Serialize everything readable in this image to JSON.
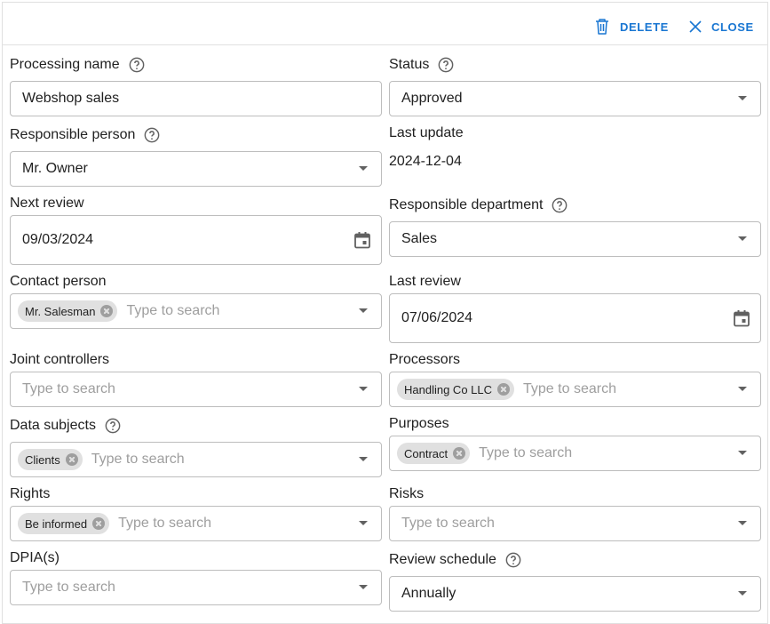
{
  "toolbar": {
    "delete_label": "DELETE",
    "close_label": "CLOSE"
  },
  "placeholder": "Type to search",
  "left": {
    "processing_name": {
      "label": "Processing name",
      "value": "Webshop sales"
    },
    "responsible_person": {
      "label": "Responsible person",
      "value": "Mr. Owner"
    },
    "next_review": {
      "label": "Next review",
      "value": "09/03/2024"
    },
    "contact_person": {
      "label": "Contact person",
      "chip": "Mr. Salesman"
    },
    "joint_controllers": {
      "label": "Joint controllers"
    },
    "data_subjects": {
      "label": "Data subjects",
      "chip": "Clients"
    },
    "rights": {
      "label": "Rights",
      "chip": "Be informed"
    },
    "dpias": {
      "label": "DPIA(s)"
    }
  },
  "right": {
    "status": {
      "label": "Status",
      "value": "Approved"
    },
    "last_update": {
      "label": "Last update",
      "value": "2024-12-04"
    },
    "responsible_department": {
      "label": "Responsible department",
      "value": "Sales"
    },
    "last_review": {
      "label": "Last review",
      "value": "07/06/2024"
    },
    "processors": {
      "label": "Processors",
      "chip": "Handling Co LLC"
    },
    "purposes": {
      "label": "Purposes",
      "chip": "Contract"
    },
    "risks": {
      "label": "Risks"
    },
    "review_schedule": {
      "label": "Review schedule",
      "value": "Annually"
    }
  },
  "colors": {
    "accent": "#1976d2",
    "border": "#bdbdbd",
    "chip": "#e0e0e0",
    "placeholder": "#9e9e9e"
  },
  "icons": {
    "delete": "trash-icon",
    "close": "close-icon",
    "help": "help-circle-icon",
    "calendar": "calendar-icon",
    "dropdown": "chevron-down-icon",
    "chip_remove": "cancel-circle-icon"
  }
}
